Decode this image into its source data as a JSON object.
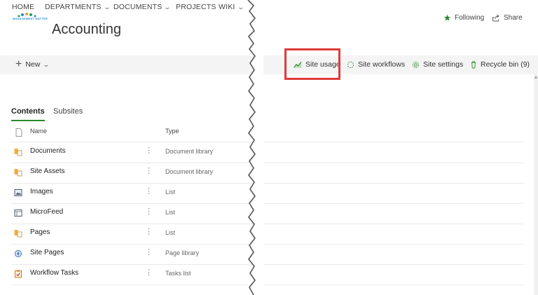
{
  "topnav": {
    "items": [
      {
        "label": "HOME",
        "has_dropdown": false
      },
      {
        "label": "DEPARTMENTS",
        "has_dropdown": true
      },
      {
        "label": "DOCUMENTS",
        "has_dropdown": true
      },
      {
        "label": "PROJECTS",
        "has_dropdown": false
      },
      {
        "label": "WIKI",
        "has_dropdown": true
      }
    ]
  },
  "site": {
    "title": "Accounting",
    "logo_text": "MANAGEMENT MATTER"
  },
  "header_actions": {
    "following_label": "Following",
    "share_label": "Share"
  },
  "commandbar": {
    "new_label": "New",
    "site_usage_label": "Site usage",
    "site_workflows_label": "Site workflows",
    "site_settings_label": "Site settings",
    "recycle_bin_label": "Recycle bin (9)"
  },
  "tabs": {
    "contents_label": "Contents",
    "subsites_label": "Subsites"
  },
  "columns": {
    "name_label": "Name",
    "type_label": "Type"
  },
  "rows": [
    {
      "name": "Documents",
      "type": "Document library",
      "icon": "library-icon"
    },
    {
      "name": "Site Assets",
      "type": "Document library",
      "icon": "library-icon"
    },
    {
      "name": "Images",
      "type": "List",
      "icon": "image-list-icon"
    },
    {
      "name": "MicroFeed",
      "type": "List",
      "icon": "list-icon"
    },
    {
      "name": "Pages",
      "type": "List",
      "icon": "library-icon"
    },
    {
      "name": "Site Pages",
      "type": "Page library",
      "icon": "page-library-icon"
    },
    {
      "name": "Workflow Tasks",
      "type": "Tasks list",
      "icon": "tasks-list-icon"
    }
  ],
  "colors": {
    "accent_green": "#2a8a2a",
    "highlight_red": "#e03a3a",
    "command_bar_bg": "#f4f4f4"
  }
}
